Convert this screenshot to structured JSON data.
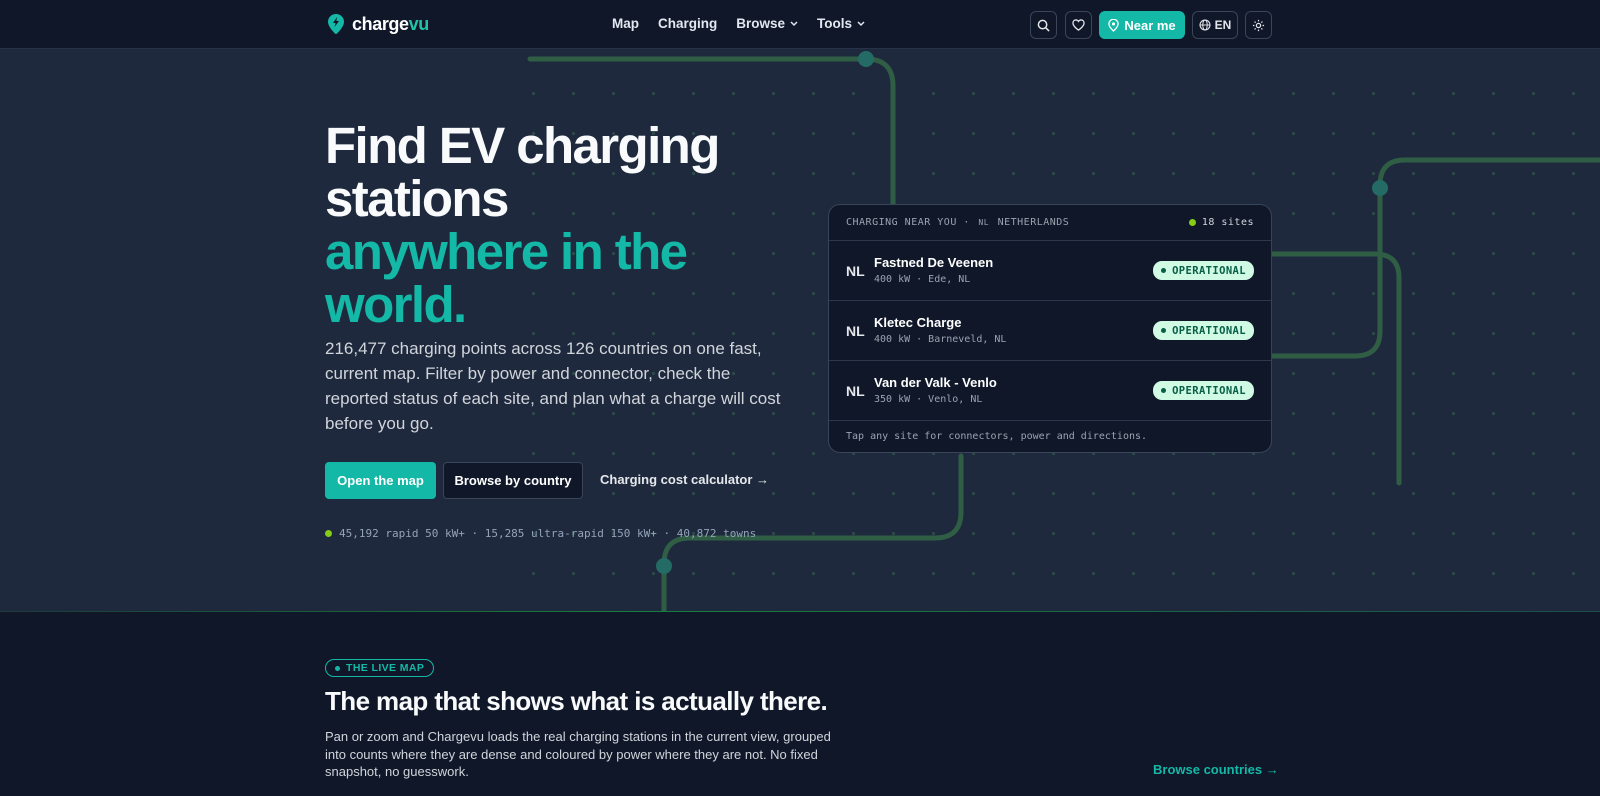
{
  "nav": {
    "brand_pre": "charge",
    "brand_post": "vu",
    "items": [
      {
        "label": "Map"
      },
      {
        "label": "Charging"
      },
      {
        "label": "Browse"
      },
      {
        "label": "Tools"
      }
    ],
    "near_me": "Near me",
    "lang": "EN",
    "icons": [
      "search-icon",
      "heart-icon",
      "map-pin-icon",
      "globe-icon",
      "sun-icon"
    ]
  },
  "hero": {
    "title_line1": "Find EV charging",
    "title_line2": "stations",
    "title_accent1": "anywhere in the",
    "title_accent2": "world.",
    "description": "216,477 charging points across 126 countries on one fast, current map. Filter by power and connector, check the reported status of each site, and plan what a charge will cost before you go.",
    "btn_primary": "Open the map",
    "btn_secondary": "Browse by country",
    "btn_link": "Charging cost calculator →",
    "stats": "45,192 rapid 50 kW+ · 15,285 ultra-rapid 150 kW+ · 40,872 towns"
  },
  "card": {
    "header_left": "CHARGING NEAR YOU ·",
    "header_flag": "NL",
    "header_country": "NETHERLANDS",
    "header_right": "18 sites",
    "rows": [
      {
        "cc": "NL",
        "name": "Fastned De Veenen",
        "meta": "400 kW · Ede, NL",
        "status": "OPERATIONAL"
      },
      {
        "cc": "NL",
        "name": "Kletec Charge",
        "meta": "400 kW · Barneveld, NL",
        "status": "OPERATIONAL"
      },
      {
        "cc": "NL",
        "name": "Van der Valk - Venlo",
        "meta": "350 kW · Venlo, NL",
        "status": "OPERATIONAL"
      }
    ],
    "footer": "Tap any site for connectors, power and directions."
  },
  "section": {
    "badge": "THE LIVE MAP",
    "title": "The map that shows what is actually there.",
    "description": "Pan or zoom and Chargevu loads the real charging stations in the current view, grouped into counts where they are dense and coloured by power where they are not. No fixed snapshot, no guesswork.",
    "browse": "Browse countries →"
  },
  "colors": {
    "accent": "#14b8a6",
    "background": "#0f1729",
    "hero_bg": "#1e293d",
    "route_line": "#2f5e45",
    "status_ok_bg": "#d1fae5"
  }
}
